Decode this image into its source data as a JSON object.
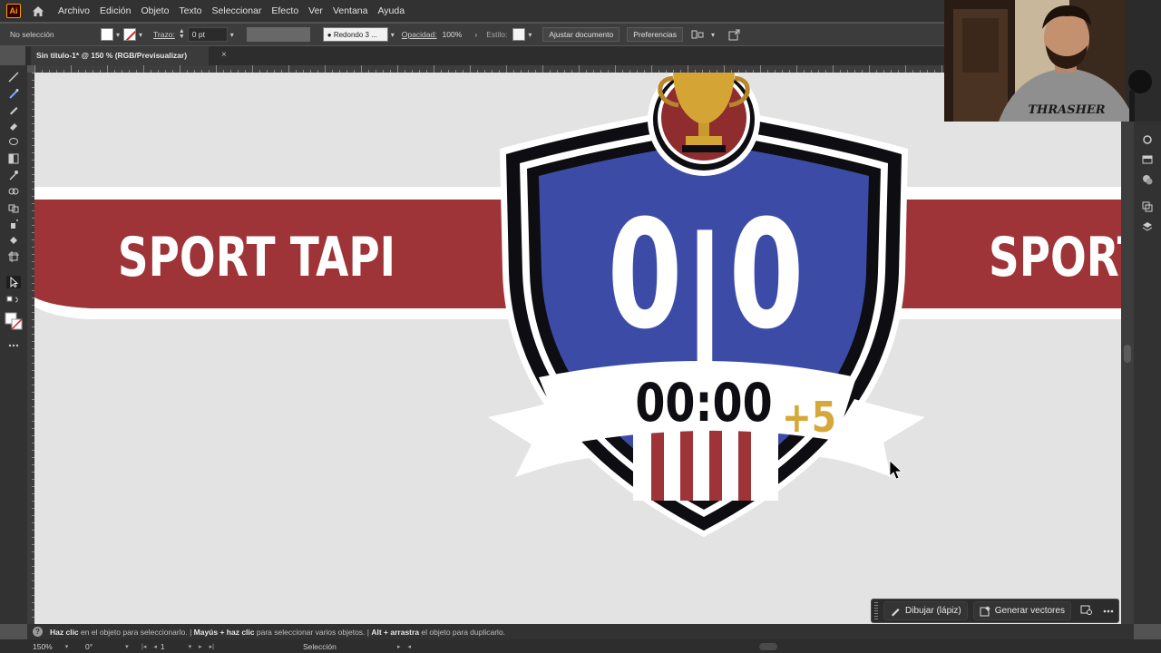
{
  "app": {
    "logo_text": "Ai"
  },
  "menu": [
    "Archivo",
    "Edición",
    "Objeto",
    "Texto",
    "Seleccionar",
    "Efecto",
    "Ver",
    "Ventana",
    "Ayuda"
  ],
  "control": {
    "selection_state": "No selección",
    "stroke_label": "Trazo:",
    "stroke_value": "0 pt",
    "brush_value": "Redondo 3 ...",
    "opacity_label": "Opacidad:",
    "opacity_value": "100%",
    "style_label": "Estilo:",
    "document_button": "Ajustar documento",
    "preferences_button": "Preferencias"
  },
  "document_tab": {
    "title": "Sin título-1* @ 150 % (RGB/Previsualizar)",
    "close_symbol": "×"
  },
  "artwork": {
    "banner_text": "SPORT TAPI",
    "banner_text_repeat": "SPORT",
    "score_home": "0",
    "score_separator": "|",
    "score_away": "0",
    "clock": "00:00",
    "added_time": "+5",
    "colors": {
      "banner_red": "#9e3437",
      "shield_blue": "#3c4ca6",
      "shield_outline": "#0d0d12",
      "trophy_gold": "#d4a435",
      "added_time_gold": "#d6a83a",
      "canvas": "#e3e3e3"
    }
  },
  "taskbar": {
    "draw_button": "Dibujar (lápiz)",
    "vectors_button": "Generar vectores"
  },
  "hint": {
    "part1_bold": "Haz clic",
    "part1": "en el objeto para seleccionarlo.",
    "part2_bold": "Mayús + haz clic",
    "part2": "para seleccionar varios objetos.",
    "part3_bold": "Alt + arrastra",
    "part3": "el objeto para duplicarlo."
  },
  "status": {
    "zoom": "150%",
    "rotation": "0°",
    "artboard": "1",
    "tool": "Selección"
  }
}
